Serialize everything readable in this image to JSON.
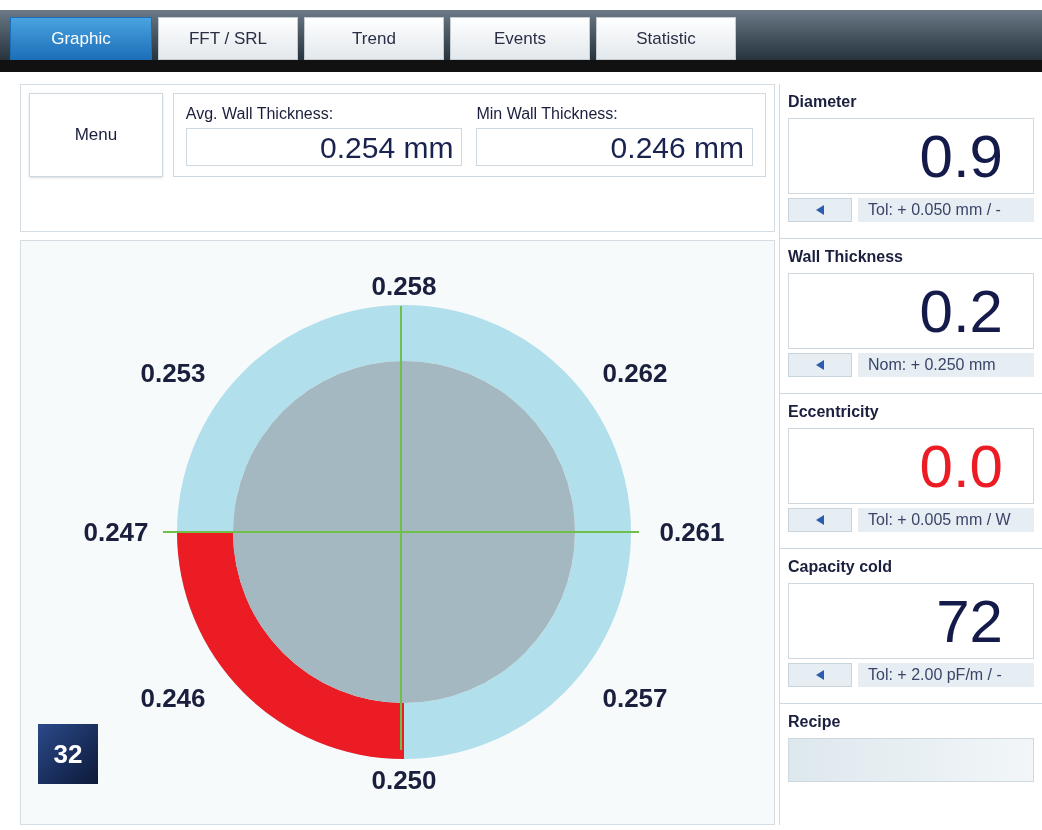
{
  "tabs": [
    {
      "label": "Graphic",
      "selected": true
    },
    {
      "label": "FFT / SRL",
      "selected": false
    },
    {
      "label": "Trend",
      "selected": false
    },
    {
      "label": "Events",
      "selected": false
    },
    {
      "label": "Statistic",
      "selected": false
    }
  ],
  "menu_button": "Menu",
  "summary": [
    {
      "label": "Avg. Wall Thickness:",
      "value": "0.254 mm"
    },
    {
      "label": "Min Wall Thickness:",
      "value": "0.246 mm"
    }
  ],
  "wall_diagram": {
    "sectors": [
      {
        "label": "0.258",
        "alarm": false
      },
      {
        "label": "0.262",
        "alarm": false
      },
      {
        "label": "0.261",
        "alarm": false
      },
      {
        "label": "0.257",
        "alarm": false
      },
      {
        "label": "0.250",
        "alarm": false
      },
      {
        "label": "0.246",
        "alarm": true
      },
      {
        "label": "0.247",
        "alarm": false
      },
      {
        "label": "0.253",
        "alarm": false
      }
    ]
  },
  "figure_number": "32",
  "measurements": [
    {
      "title": "Diameter",
      "value": "0.9",
      "alarm": false,
      "tolerance": "Tol: + 0.050 mm / -"
    },
    {
      "title": "Wall Thickness",
      "value": "0.2",
      "alarm": false,
      "tolerance": "Nom: + 0.250 mm"
    },
    {
      "title": "Eccentricity",
      "value": "0.0",
      "alarm": true,
      "tolerance": "Tol: + 0.005 mm / W"
    },
    {
      "title": "Capacity cold",
      "value": "72",
      "alarm": false,
      "tolerance": "Tol: + 2.00 pF/m / -"
    }
  ],
  "recipe": {
    "title": "Recipe"
  }
}
